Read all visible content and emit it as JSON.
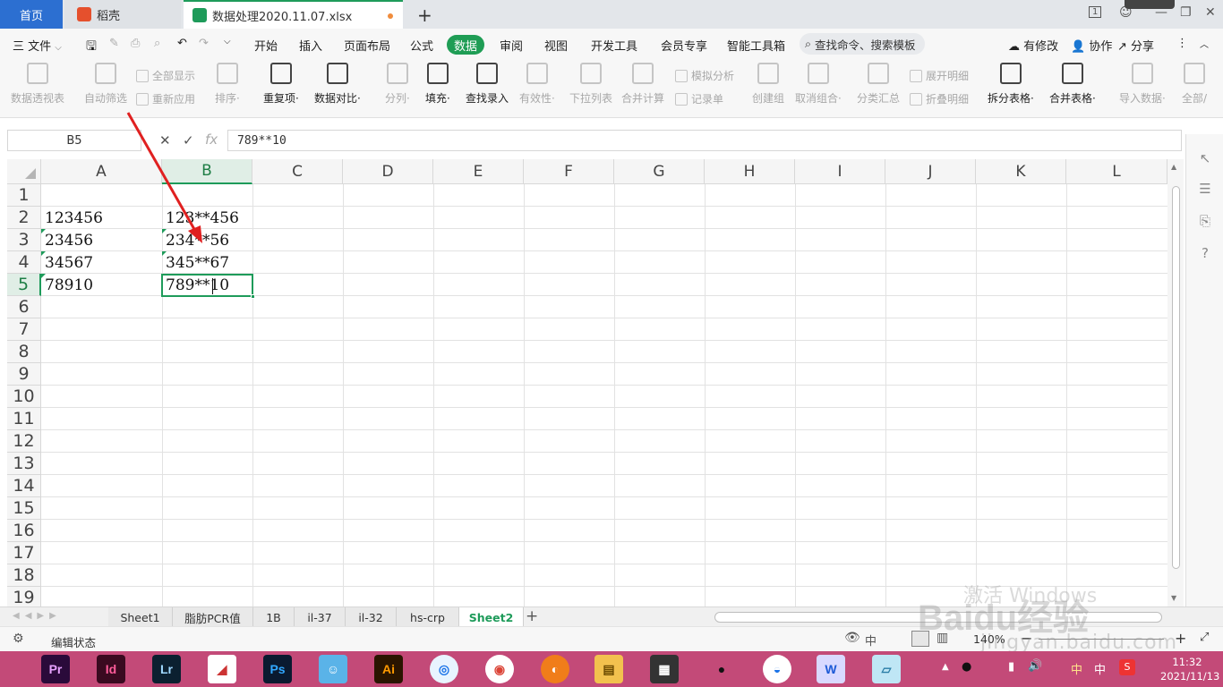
{
  "tabs": {
    "home": "首页",
    "docer": "稻壳",
    "file": "数据处理2020.11.07.xlsx",
    "add": "+"
  },
  "window": {
    "badge": "1"
  },
  "menu": {
    "file": "三 文件",
    "items": [
      "开始",
      "插入",
      "页面布局",
      "公式",
      "数据",
      "审阅",
      "视图",
      "开发工具",
      "会员专享",
      "智能工具箱"
    ],
    "search": "查找命令、搜索模板",
    "right": [
      "有修改",
      "协作",
      "分享"
    ]
  },
  "ribbon": {
    "big": [
      {
        "label": "数据透视表",
        "on": false
      },
      {
        "label": "自动筛选",
        "on": false
      },
      {
        "label": "排序·",
        "on": false
      },
      {
        "label": "重复项·",
        "on": true
      },
      {
        "label": "数据对比·",
        "on": true
      },
      {
        "label": "分列·",
        "on": false
      },
      {
        "label": "填充·",
        "on": true
      },
      {
        "label": "查找录入",
        "on": true
      },
      {
        "label": "有效性·",
        "on": false
      },
      {
        "label": "下拉列表",
        "on": false
      },
      {
        "label": "合并计算",
        "on": false
      },
      {
        "label": "创建组",
        "on": false
      },
      {
        "label": "取消组合·",
        "on": false
      },
      {
        "label": "分类汇总",
        "on": false
      },
      {
        "label": "拆分表格·",
        "on": true
      },
      {
        "label": "合并表格·",
        "on": true
      },
      {
        "label": "导入数据·",
        "on": false
      },
      {
        "label": "全部/",
        "on": false
      }
    ],
    "small": [
      "全部显示",
      "重新应用",
      "模拟分析",
      "记录单",
      "展开明细",
      "折叠明细"
    ]
  },
  "formula": {
    "namebox": "B5",
    "cancel": "✕",
    "ok": "✓",
    "fx": "fx",
    "value": "789**10"
  },
  "columns": [
    "A",
    "B",
    "C",
    "D",
    "E",
    "F",
    "G",
    "H",
    "I",
    "J",
    "K",
    "L"
  ],
  "rows": [
    "1",
    "2",
    "3",
    "4",
    "5",
    "6",
    "7",
    "8",
    "9",
    "10",
    "11",
    "12",
    "13",
    "14",
    "15",
    "16",
    "17",
    "18",
    "19"
  ],
  "cells": {
    "A2": "123456",
    "B2": "123**456",
    "A3": "23456",
    "B3": "234**56",
    "A4": "34567",
    "B4": "345**67",
    "A5": "78910",
    "B5": "789**10"
  },
  "sheets": [
    "Sheet1",
    "脂肪PCR值",
    "1B",
    "il-37",
    "il-32",
    "hs-crp",
    "Sheet2"
  ],
  "active_sheet": "Sheet2",
  "status": {
    "mode": "编辑状态",
    "zoom": "140%"
  },
  "watermark": {
    "activate": "激活 Windows",
    "logo": "Baidu经验",
    "url": "jingyan.baidu.com"
  },
  "taskbar": {
    "apps": [
      "Pr",
      "Id",
      "Lr",
      "Ps",
      "Ai"
    ],
    "time": "11:32",
    "date": "2021/11/13",
    "ime": "中"
  },
  "colors": {
    "accent": "#1e9b5a",
    "tab_home": "#2c6fd1",
    "taskbar": "#c34a78",
    "arrow": "#e02020"
  }
}
